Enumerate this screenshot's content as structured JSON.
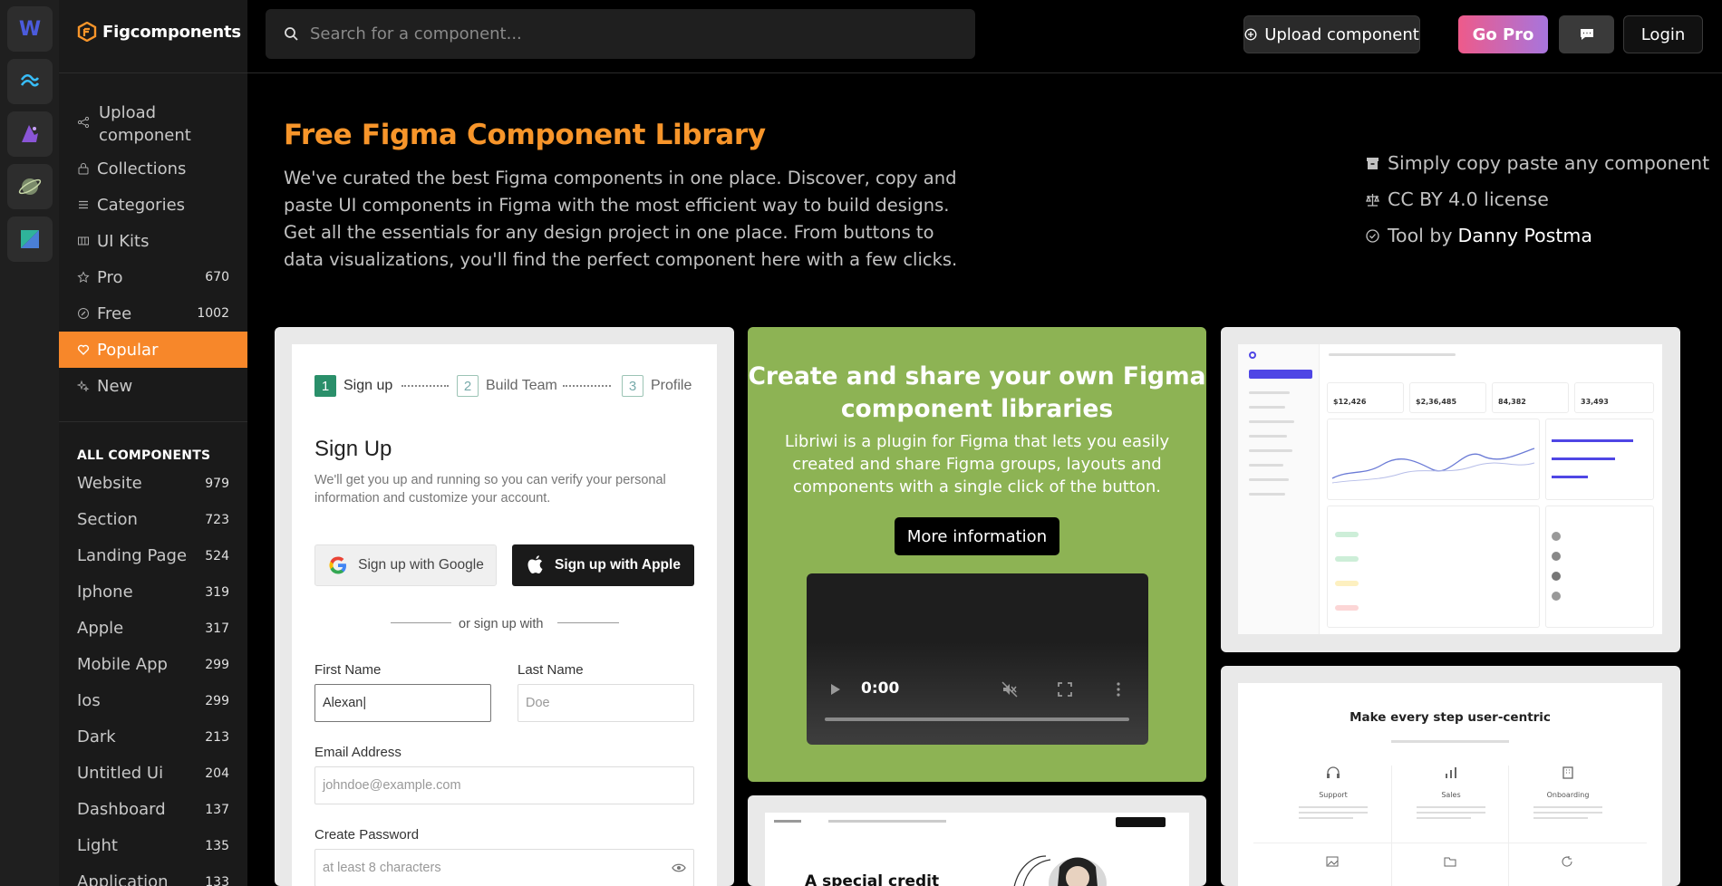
{
  "rail": {
    "apps": [
      {
        "icon": "webflow-icon",
        "glyph": "W"
      },
      {
        "icon": "tailwind-icon"
      },
      {
        "icon": "wizard-icon"
      },
      {
        "icon": "planet-icon"
      },
      {
        "icon": "kite-icon"
      }
    ]
  },
  "brand": {
    "name": "Figcomponents",
    "color": "#f7952a"
  },
  "nav": {
    "items": [
      {
        "label": "Upload component",
        "icon": "share-icon"
      },
      {
        "label": "Collections",
        "icon": "lock-icon"
      },
      {
        "label": "Categories",
        "icon": "list-icon"
      },
      {
        "label": "UI Kits",
        "icon": "columns-icon"
      },
      {
        "label": "Pro",
        "count": "670",
        "icon": "star-icon"
      },
      {
        "label": "Free",
        "count": "1002",
        "icon": "badge-icon"
      },
      {
        "label": "Popular",
        "icon": "heart-icon",
        "active": true
      },
      {
        "label": "New",
        "icon": "sparkle-icon"
      }
    ]
  },
  "all_components": {
    "title": "ALL COMPONENTS",
    "items": [
      {
        "label": "Website",
        "count": "979"
      },
      {
        "label": "Section",
        "count": "723"
      },
      {
        "label": "Landing Page",
        "count": "524"
      },
      {
        "label": "Iphone",
        "count": "319"
      },
      {
        "label": "Apple",
        "count": "317"
      },
      {
        "label": "Mobile App",
        "count": "299"
      },
      {
        "label": "Ios",
        "count": "299"
      },
      {
        "label": "Dark",
        "count": "213"
      },
      {
        "label": "Untitled Ui",
        "count": "204"
      },
      {
        "label": "Dashboard",
        "count": "137"
      },
      {
        "label": "Light",
        "count": "135"
      },
      {
        "label": "Application",
        "count": "133"
      }
    ]
  },
  "search": {
    "placeholder": "Search for a component..."
  },
  "topbar": {
    "upload_label": "Upload component",
    "pro_label": "Go Pro",
    "login_label": "Login"
  },
  "hero": {
    "title": "Free Figma Component Library",
    "description": "We've curated the best Figma components in one place. Discover, copy and paste UI components in Figma with the most efficient way to build designs. Get all the essentials for any design project in one place. From buttons to data visualizations, you'll find the perfect component here with a few clicks.",
    "features": [
      {
        "icon": "archive-icon",
        "text": "Simply copy paste any component"
      },
      {
        "icon": "scale-icon",
        "text": "CC BY 4.0 license"
      },
      {
        "icon": "check-circle-icon",
        "text": "Tool by",
        "link": "Danny Postma"
      }
    ]
  },
  "signup_card": {
    "steps": [
      {
        "num": "1",
        "label": "Sign up"
      },
      {
        "num": "2",
        "label": "Build Team"
      },
      {
        "num": "3",
        "label": "Profile"
      }
    ],
    "heading": "Sign Up",
    "subtext": "We'll get you up and running so you can verify your personal information and customize your account.",
    "google": "Sign up with Google",
    "apple": "Sign up with Apple",
    "or": "or sign up with",
    "first_label": "First Name",
    "first_value": "Alexan|",
    "last_label": "Last Name",
    "last_placeholder": "Doe",
    "email_label": "Email Address",
    "email_placeholder": "johndoe@example.com",
    "password_label": "Create Password",
    "password_placeholder": "at least 8 characters"
  },
  "promo_card": {
    "title": "Create and share your own Figma component libraries",
    "description": "Libriwi is a plugin for Figma that lets you easily created and share Figma groups, layouts and components with a single click of the button.",
    "button": "More information",
    "video_time": "0:00",
    "bg_color": "#8db354"
  },
  "dashboard_preview": {
    "stats": [
      "$12,426",
      "$2,36,485",
      "84,382",
      "33,493"
    ]
  },
  "features_preview": {
    "title": "Make every step user-centric",
    "items": [
      "Support",
      "Sales",
      "Onboarding"
    ]
  },
  "hero_preview": {
    "headline": "A special credit"
  }
}
